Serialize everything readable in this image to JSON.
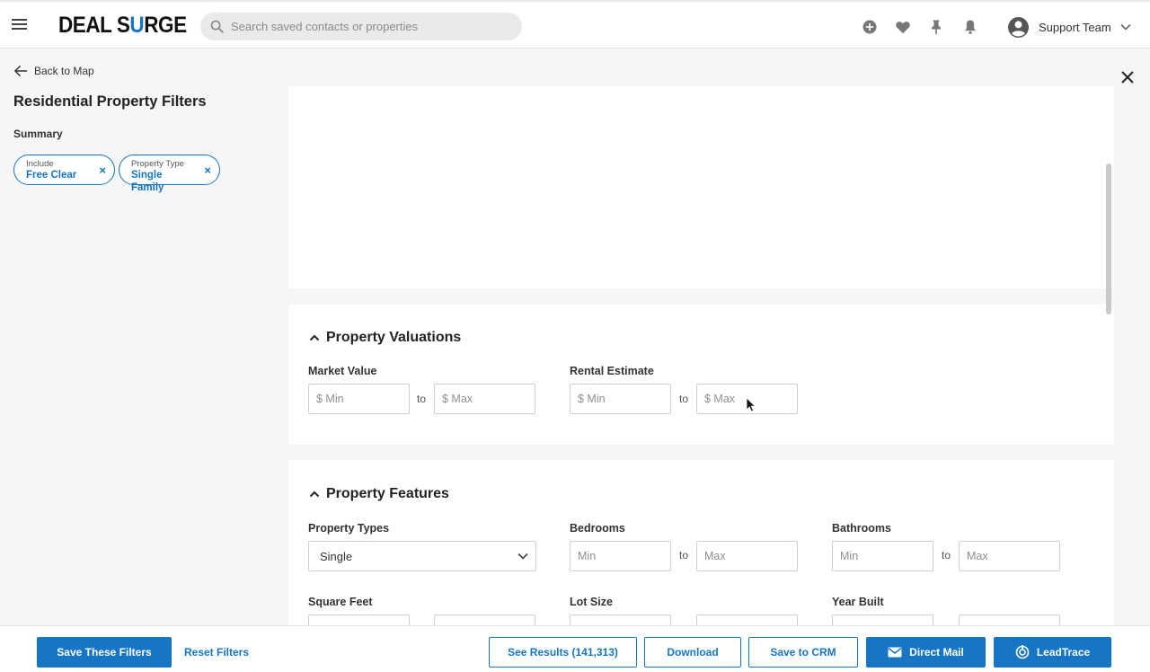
{
  "app": {
    "logo_part1": "DEAL S",
    "logo_accent": "U",
    "logo_part2": "RGE"
  },
  "header": {
    "search_placeholder": "Search saved contacts or properties",
    "icons": [
      "add-icon",
      "heart-icon",
      "pin-icon",
      "bell-icon"
    ],
    "user_name": "Support Team"
  },
  "sidebar": {
    "back_label": "Back to Map",
    "title": "Residential Property Filters",
    "summary_label": "Summary",
    "chips": [
      {
        "key": "Include",
        "value": "Free Clear",
        "remove": "×"
      },
      {
        "key": "Property Type",
        "value": "Single Family",
        "remove": "×"
      }
    ]
  },
  "valuations": {
    "title": "Property Valuations",
    "market_value": {
      "label": "Market Value",
      "min_placeholder": "$ Min",
      "max_placeholder": "$ Max",
      "to": "to"
    },
    "rental_estimate": {
      "label": "Rental Estimate",
      "min_placeholder": "$ Min",
      "max_placeholder": "$ Max",
      "to": "to"
    }
  },
  "features": {
    "title": "Property Features",
    "property_types": {
      "label": "Property Types",
      "value": "Single"
    },
    "bedrooms": {
      "label": "Bedrooms",
      "min_placeholder": "Min",
      "max_placeholder": "Max",
      "to": "to"
    },
    "bathrooms": {
      "label": "Bathrooms",
      "min_placeholder": "Min",
      "max_placeholder": "Max",
      "to": "to"
    },
    "square_feet": {
      "label": "Square Feet"
    },
    "lot_size": {
      "label": "Lot Size"
    },
    "year_built": {
      "label": "Year Built"
    }
  },
  "footer": {
    "save_filters": "Save These Filters",
    "reset_filters": "Reset Filters",
    "see_results": "See Results (141,313)",
    "download": "Download",
    "save_to_crm": "Save to CRM",
    "direct_mail": "Direct Mail",
    "leadtrace": "LeadTrace"
  },
  "colors": {
    "accent": "#1676c5",
    "background": "#f6f6f6"
  }
}
